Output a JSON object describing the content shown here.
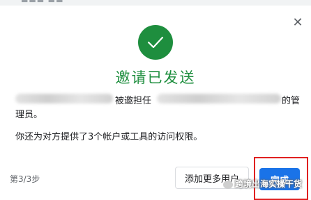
{
  "background_strip": {
    "ghost_text": "▬▬▬  ▬▬"
  },
  "dialog": {
    "close_glyph": "✕",
    "title": "邀请已发送",
    "message_line1_segments": [
      "被邀担任",
      "的管"
    ],
    "message_line2": "理员。",
    "message_line3": "你还为对方提供了3个帐户或工具的访问权限。",
    "step_indicator": "第3/3步",
    "add_more_users_button": "添加更多用户",
    "done_button": "完成"
  },
  "watermark": {
    "text": "跨境出海实操干货"
  },
  "colors": {
    "success_green": "#1e8e3e",
    "primary_blue": "#1a73e8",
    "highlight_red": "#e02020"
  }
}
